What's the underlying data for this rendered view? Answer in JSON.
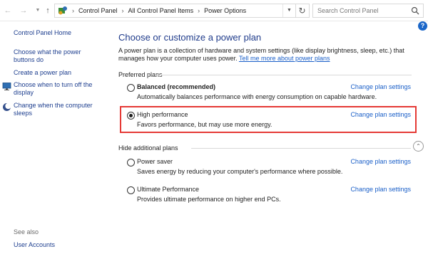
{
  "address": {
    "crumbs": [
      "Control Panel",
      "All Control Panel Items",
      "Power Options"
    ],
    "search_placeholder": "Search Control Panel"
  },
  "left": {
    "home": "Control Panel Home",
    "buttons": "Choose what the power buttons do",
    "create": "Create a power plan",
    "display": "Choose when to turn off the display",
    "sleep": "Change when the computer sleeps",
    "see_also": "See also",
    "user_accounts": "User Accounts"
  },
  "main": {
    "title": "Choose or customize a power plan",
    "description": "A power plan is a collection of hardware and system settings (like display brightness, sleep, etc.) that manages how your computer uses power.",
    "more_link": "Tell me more about power plans",
    "preferred_label": "Preferred plans",
    "hide_label": "Hide additional plans",
    "plans": [
      {
        "name": "Balanced (recommended)",
        "desc": "Automatically balances performance with energy consumption on capable hardware.",
        "link": "Change plan settings",
        "selected": false
      },
      {
        "name": "High performance",
        "desc": "Favors performance, but may use more energy.",
        "link": "Change plan settings",
        "selected": true
      },
      {
        "name": "Power saver",
        "desc": "Saves energy by reducing your computer's performance where possible.",
        "link": "Change plan settings",
        "selected": false
      },
      {
        "name": "Ultimate Performance",
        "desc": "Provides ultimate performance on higher end PCs.",
        "link": "Change plan settings",
        "selected": false
      }
    ]
  },
  "colors": {
    "link": "#1a5fc8",
    "title": "#1e3a8a",
    "highlight_border": "#e53935"
  }
}
